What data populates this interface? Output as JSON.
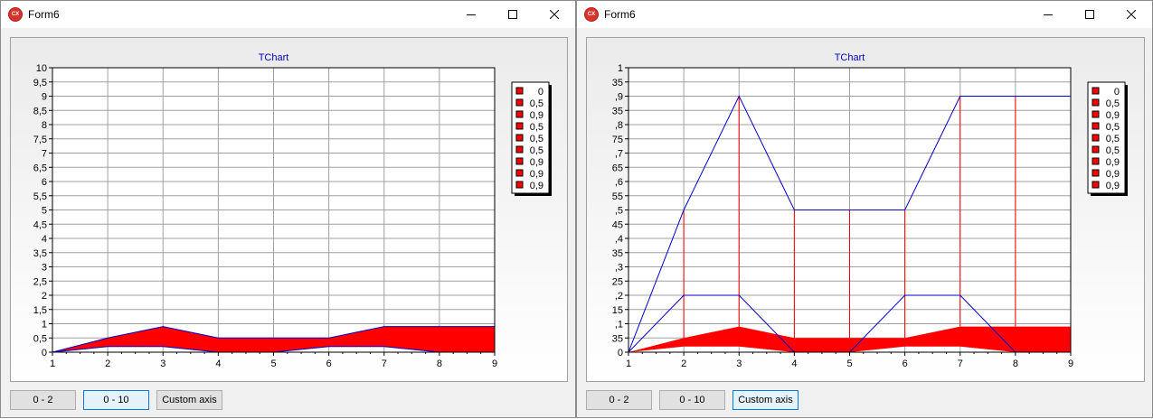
{
  "windows": [
    {
      "title": "Form6",
      "app_icon_text": "CX",
      "buttons": [
        {
          "label": "0 - 2",
          "active": false
        },
        {
          "label": "0 - 10",
          "active": true
        },
        {
          "label": "Custom axis",
          "active": false
        }
      ]
    },
    {
      "title": "Form6",
      "app_icon_text": "CX",
      "buttons": [
        {
          "label": "0 - 2",
          "active": false
        },
        {
          "label": "0 - 10",
          "active": false
        },
        {
          "label": "Custom axis",
          "active": true
        }
      ]
    }
  ],
  "chart_data": [
    {
      "type": "area",
      "title": "TChart",
      "x": [
        1,
        2,
        3,
        4,
        5,
        6,
        7,
        8,
        9
      ],
      "x_ticks": [
        "1",
        "2",
        "3",
        "4",
        "5",
        "6",
        "7",
        "8",
        "9"
      ],
      "ylim": [
        0,
        10
      ],
      "y_ticks": [
        0,
        0.5,
        1,
        1.5,
        2,
        2.5,
        3,
        3.5,
        4,
        4.5,
        5,
        5.5,
        6,
        6.5,
        7,
        7.5,
        8,
        8.5,
        9,
        9.5,
        10
      ],
      "y_tick_labels": [
        "0",
        "0,5",
        "1",
        "1,5",
        "2",
        "2,5",
        "3",
        "3,5",
        "4",
        "4,5",
        "5",
        "5,5",
        "6",
        "6,5",
        "7",
        "7,5",
        "8",
        "8,5",
        "9",
        "9,5",
        "10"
      ],
      "upper": [
        0,
        0.5,
        0.9,
        0.5,
        0.5,
        0.5,
        0.9,
        0.9,
        0.9
      ],
      "lower": [
        0,
        0.2,
        0.2,
        0,
        0,
        0.2,
        0.2,
        0,
        0
      ],
      "legend": [
        "0",
        "0,5",
        "0,9",
        "0,5",
        "0,5",
        "0,5",
        "0,9",
        "0,9",
        "0,9"
      ],
      "grid": true,
      "legend_position": "right",
      "colors": {
        "fill": "#ff0000",
        "line": "#0000cc",
        "grid": "#a0a0a0",
        "title": "#0000cc"
      }
    },
    {
      "type": "area",
      "title": "TChart",
      "x": [
        1,
        2,
        3,
        4,
        5,
        6,
        7,
        8,
        9
      ],
      "x_ticks": [
        "1",
        "2",
        "3",
        "4",
        "5",
        "6",
        "7",
        "8",
        "9"
      ],
      "ylim": [
        0,
        1
      ],
      "y_ticks": [
        0,
        0.05,
        0.1,
        0.15,
        0.2,
        0.25,
        0.3,
        0.35,
        0.4,
        0.45,
        0.5,
        0.55,
        0.6,
        0.65,
        0.7,
        0.75,
        0.8,
        0.85,
        0.9,
        0.95,
        1
      ],
      "y_tick_labels": [
        "0",
        "35",
        ",1",
        "15",
        ",2",
        "25",
        ",3",
        "35",
        ",4",
        "45",
        ",5",
        "55",
        ",6",
        "65",
        ",7",
        "75",
        ",8",
        "35",
        ",9",
        "35",
        "1"
      ],
      "upper": [
        0,
        0.5,
        0.9,
        0.5,
        0.5,
        0.5,
        0.9,
        0.9,
        0.9
      ],
      "lower": [
        0,
        0.2,
        0.2,
        0,
        0,
        0.2,
        0.2,
        0,
        0
      ],
      "fill_band": {
        "upper": [
          0,
          0.05,
          0.09,
          0.05,
          0.05,
          0.05,
          0.09,
          0.09,
          0.09
        ],
        "lower": [
          0,
          0.02,
          0.02,
          0,
          0,
          0.02,
          0.02,
          0,
          0
        ]
      },
      "legend": [
        "0",
        "0,5",
        "0,9",
        "0,5",
        "0,5",
        "0,5",
        "0,9",
        "0,9",
        "0,9"
      ],
      "grid": true,
      "legend_position": "right",
      "colors": {
        "fill": "#ff0000",
        "line": "#0000cc",
        "grid": "#a0a0a0",
        "title": "#0000cc"
      }
    }
  ]
}
